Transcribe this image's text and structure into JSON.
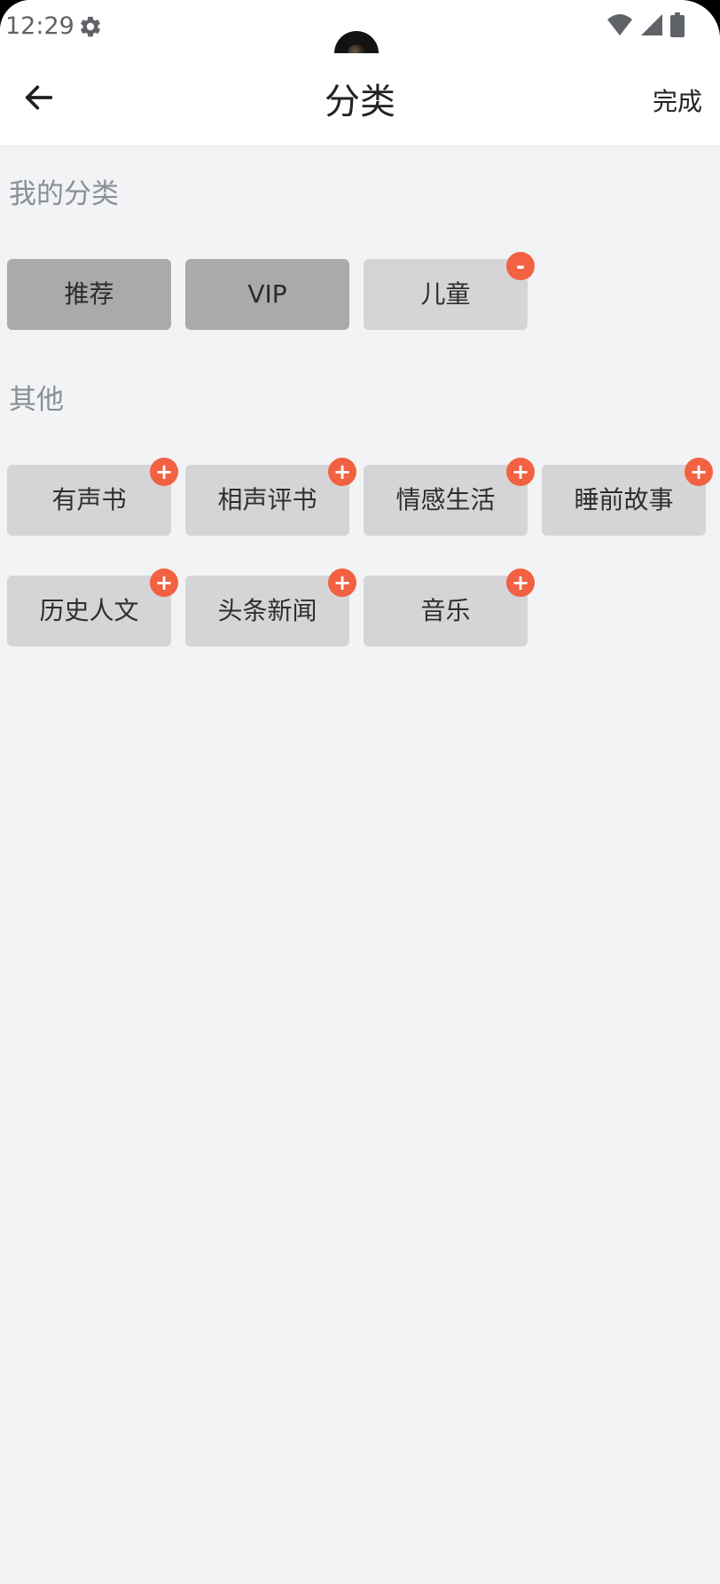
{
  "status_bar": {
    "time": "12:29",
    "settings_icon": "gear-icon",
    "wifi_icon": "wifi-icon",
    "signal_icon": "signal-icon",
    "battery_icon": "battery-icon"
  },
  "header": {
    "back_icon": "arrow-left-icon",
    "title": "分类",
    "done_label": "完成"
  },
  "sections": {
    "mine": {
      "title": "我的分类",
      "items": [
        {
          "label": "推荐",
          "state": "fixed",
          "badge": ""
        },
        {
          "label": "VIP",
          "state": "fixed",
          "badge": ""
        },
        {
          "label": "儿童",
          "state": "removable",
          "badge": "-"
        }
      ]
    },
    "others": {
      "title": "其他",
      "items": [
        {
          "label": "有声书",
          "badge": "+"
        },
        {
          "label": "相声评书",
          "badge": "+"
        },
        {
          "label": "情感生活",
          "badge": "+"
        },
        {
          "label": "睡前故事",
          "badge": "+"
        },
        {
          "label": "历史人文",
          "badge": "+"
        },
        {
          "label": "头条新闻",
          "badge": "+"
        },
        {
          "label": "音乐",
          "badge": "+"
        }
      ]
    }
  },
  "colors": {
    "background": "#F2F3F5",
    "badge": "#F26141",
    "tag": "#D5D5D7",
    "tag_fixed": "#AAAAAA"
  }
}
